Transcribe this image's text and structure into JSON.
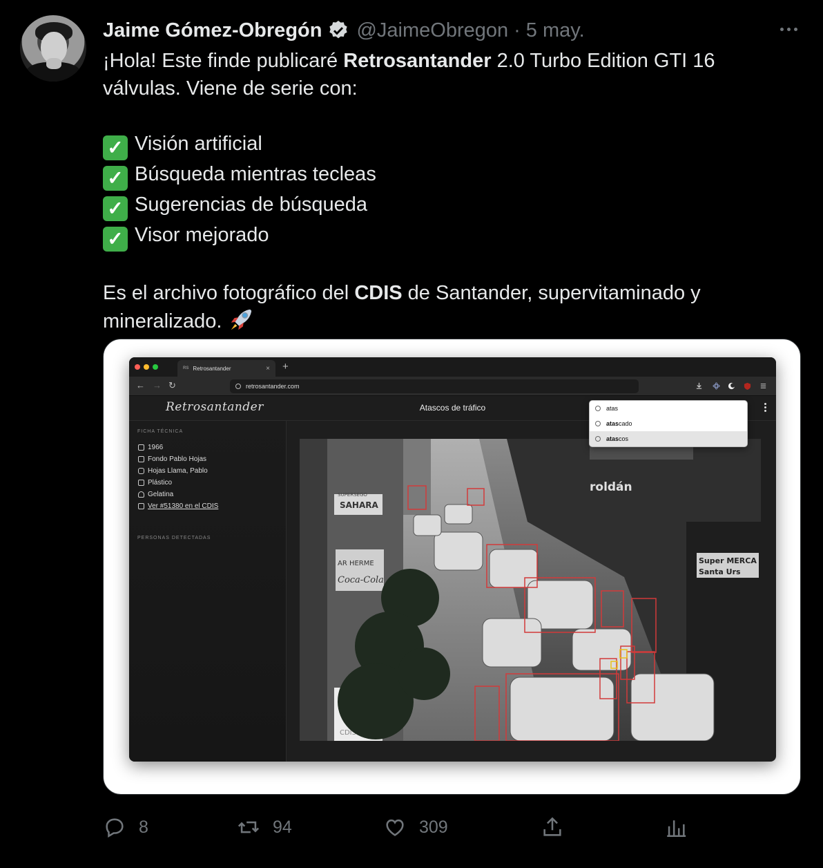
{
  "tweet": {
    "author_name": "Jaime Gómez-Obregón",
    "handle": "@JaimeObregon",
    "separator": "·",
    "date": "5 may.",
    "line1_pre": "¡Hola! Este finde publicaré ",
    "line1_bold": "Retrosantander",
    "line1_post": " 2.0 Turbo Edition GTI 16",
    "line2": "válvulas. Viene de serie con:",
    "check_glyph": "✓",
    "features": [
      "Visión artificial",
      "Búsqueda mientras tecleas",
      "Sugerencias de búsqueda",
      "Visor mejorado"
    ],
    "para2_pre": "Es el archivo fotográfico del ",
    "para2_bold": "CDIS",
    "para2_post": " de Santander, supervitaminado y",
    "para2_line2": "mineralizado. "
  },
  "screenshot": {
    "tab_favicon": "RS",
    "tab_title": "Retrosantander",
    "tab_close": "×",
    "new_tab": "+",
    "nav_back": "←",
    "nav_forward": "→",
    "nav_reload": "↻",
    "url": "retrosantander.com",
    "logo": "Retrosantander",
    "title": "Atascos de tráfico",
    "search_value": "atas",
    "suggestions": [
      {
        "bold": "atas",
        "rest": "cado"
      },
      {
        "bold": "atas",
        "rest": "cos"
      }
    ],
    "sidebar": {
      "section1": "FICHA TÉCNICA",
      "items": [
        "1966",
        "Fondo Pablo Hojas",
        "Hojas Llama, Pablo",
        "Plástico",
        "Gelatina",
        "Ver #51380 en el CDIS"
      ],
      "section2": "PERSONAS DETECTADAS"
    },
    "photo_signs": [
      "roldán",
      "SAHARA",
      "SUPERSEGO",
      "AR HERME",
      "Coca-Cola",
      "Super MERCA",
      "Santa Urs",
      "CDIS"
    ]
  },
  "actions": {
    "replies": "8",
    "retweets": "94",
    "likes": "309"
  },
  "colors": {
    "background": "#000000",
    "text": "#e7e9ea",
    "muted": "#71767b",
    "verified": "#d6d9db",
    "check": "#3fae49",
    "detection_box": "#d23a3a",
    "face_box": "#e8c21b"
  }
}
